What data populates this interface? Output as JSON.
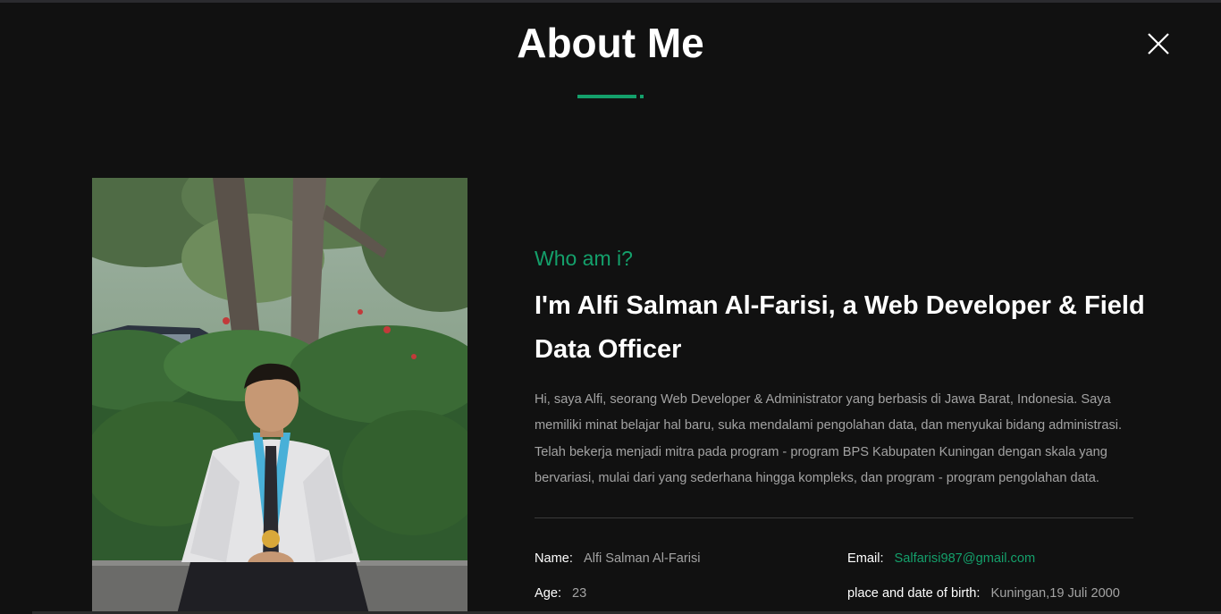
{
  "header": {
    "title": "About Me",
    "close_icon": "close-icon"
  },
  "photo": {
    "icon": "profile-photo"
  },
  "intro": {
    "subtitle": "Who am i?",
    "headline": "I'm Alfi Salman Al-Farisi, a Web Developer & Field Data Officer",
    "bio": "Hi, saya Alfi, seorang Web Developer & Administrator yang berbasis di Jawa Barat, Indonesia. Saya memiliki minat belajar hal baru, suka mendalami pengolahan data, dan menyukai bidang administrasi. Telah bekerja menjadi mitra pada program - program BPS Kabupaten Kuningan dengan skala yang bervariasi, mulai dari yang sederhana hingga kompleks, dan program - program pengolahan data."
  },
  "details": {
    "name_label": "Name:",
    "name_value": "Alfi Salman Al-Farisi",
    "age_label": "Age:",
    "age_value": "23",
    "email_label": "Email:",
    "email_value": "Salfarisi987@gmail.com",
    "birth_label": "place and date of birth:",
    "birth_value": "Kuningan,19 Juli 2000"
  },
  "colors": {
    "background": "#111111",
    "accent": "#14a06b",
    "heading": "#ffffff",
    "muted_text": "#a3a3a3"
  }
}
